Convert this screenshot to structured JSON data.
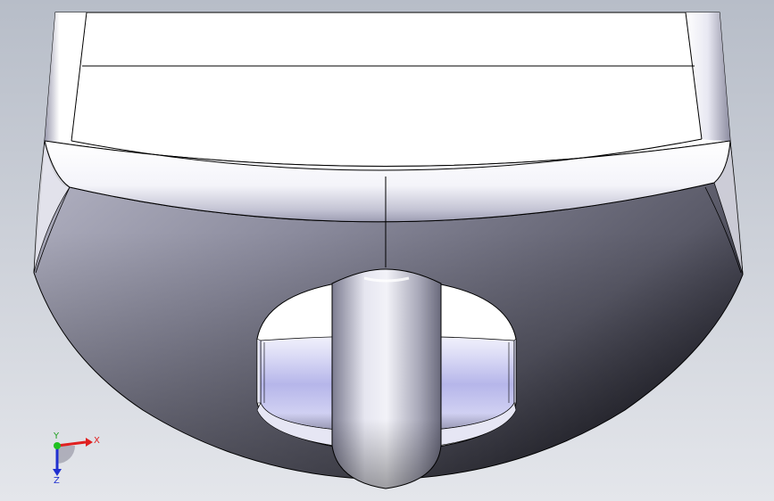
{
  "viewport": {
    "background_top": "#b9bfca",
    "background_bottom": "#dfe2e8",
    "edge_color": "#000000"
  },
  "triad": {
    "x_label": "X",
    "y_label": "Y",
    "z_label": "Z",
    "x_color": "#e02020",
    "y_color": "#20c020",
    "z_color": "#2030d0"
  }
}
